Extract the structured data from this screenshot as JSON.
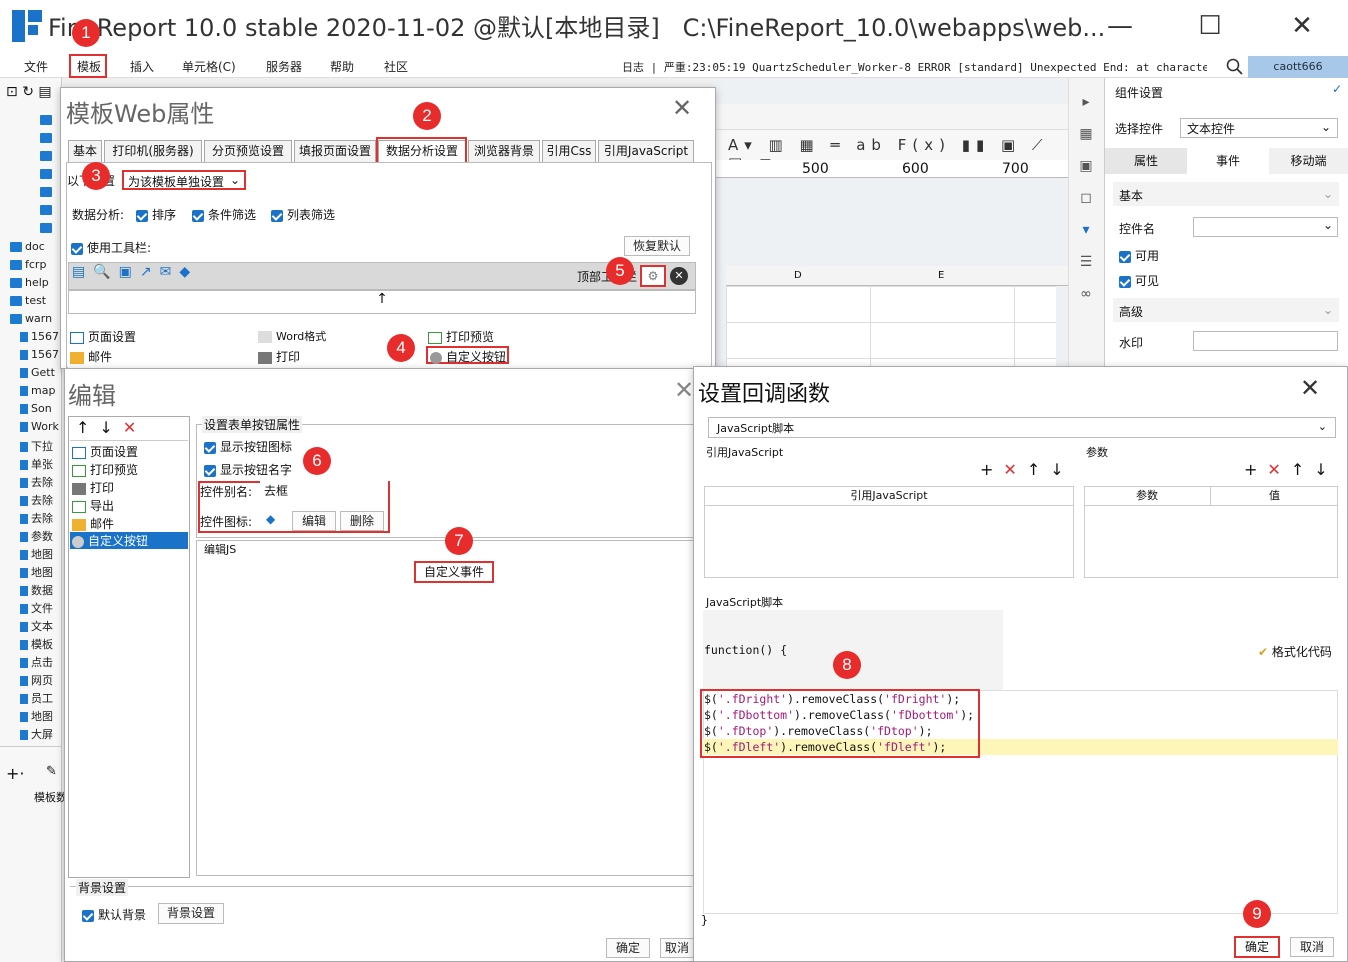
{
  "app": {
    "title": "FineReport 10.0 stable 2020-11-02 @默认[本地目录]",
    "path": "C:\\FineReport_10.0\\webapps\\web..."
  },
  "menu": [
    "文件",
    "模板",
    "插入",
    "单元格(C)",
    "服务器",
    "帮助",
    "社区"
  ],
  "log": {
    "label": "日志",
    "text": "| 严重:23:05:19 QuartzScheduler_Worker-8 ERROR [standard] Unexpected End: at character 0 of"
  },
  "user": "caott666",
  "tree": {
    "folders": [
      "doc",
      "fcrp",
      "help",
      "test",
      "warn"
    ],
    "files": [
      "1567",
      "1567",
      "Gett",
      "map",
      "Son",
      "Work",
      "下拉",
      "单张",
      "去除",
      "去除",
      "去除",
      "参数",
      "地图",
      "地图",
      "数据",
      "文件",
      "文本",
      "模板",
      "点击",
      "网页",
      "员工",
      "地图",
      "大屏"
    ]
  },
  "left_bottom": {
    "label": "模板数"
  },
  "right_panel": {
    "title": "组件设置",
    "select_label": "选择控件",
    "select_value": "文本控件",
    "tabs": [
      "属性",
      "事件",
      "移动端"
    ],
    "basic": "基本",
    "name_label": "控件名",
    "usable": "可用",
    "visible": "可见",
    "advanced": "高级",
    "watermark": "水印"
  },
  "ruler": [
    "500",
    "600",
    "700"
  ],
  "columns": [
    "D",
    "E"
  ],
  "web_dialog": {
    "title": "模板Web属性",
    "tabs": [
      "基本",
      "打印机(服务器)",
      "分页预览设置",
      "填报页面设置",
      "数据分析设置",
      "浏览器背景",
      "引用Css",
      "引用JavaScript"
    ],
    "setting_prefix": "以下设置",
    "setting_value": "为该模板单独设置",
    "analysis_label": "数据分析:",
    "analysis_opts": [
      "排序",
      "条件筛选",
      "列表筛选"
    ],
    "use_toolbar": "使用工具栏:",
    "restore": "恢复默认",
    "top_toolbar": "顶部工具栏",
    "buttons": [
      [
        "页面设置",
        "Word格式",
        "打印预览"
      ],
      [
        "邮件",
        "打印",
        "自定义按钮"
      ]
    ]
  },
  "edit_dialog": {
    "title": "编辑",
    "list": [
      "页面设置",
      "打印预览",
      "打印",
      "导出",
      "邮件",
      "自定义按钮"
    ],
    "group_title": "设置表单按钮属性",
    "show_icon": "显示按钮图标",
    "show_name": "显示按钮名字",
    "alias_label": "控件别名:",
    "alias_value": "去框",
    "icon_label": "控件图标:",
    "edit": "编辑",
    "delete": "删除",
    "edit_js": "编辑JS",
    "custom_event": "自定义事件",
    "bg_title": "背景设置",
    "default_bg": "默认背景",
    "bg_setting": "背景设置",
    "ok": "确定",
    "cancel": "取消"
  },
  "cb_dialog": {
    "title": "设置回调函数",
    "type": "JavaScript脚本",
    "ref_js": "引用JavaScript",
    "params": "参数",
    "col_ref": "引用JavaScript",
    "col_param": "参数",
    "col_value": "值",
    "script_label": "JavaScript脚本",
    "fn_head": "function() {",
    "format": "格式化代码",
    "code": [
      "$('.fDright').removeClass('fDright');",
      "$('.fDbottom').removeClass('fDbottom');",
      "$('.fDtop').removeClass('fDtop');",
      "$('.fDleft').removeClass('fDleft');"
    ],
    "fn_end": "}",
    "ok": "确定",
    "cancel": "取消"
  },
  "badges": [
    "1",
    "2",
    "3",
    "4",
    "5",
    "6",
    "7",
    "8",
    "9"
  ]
}
